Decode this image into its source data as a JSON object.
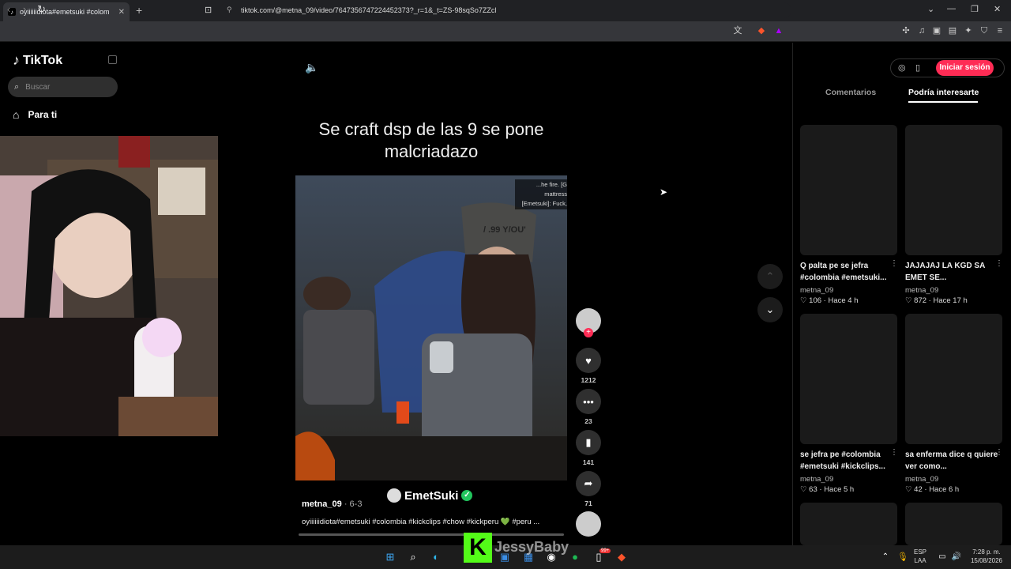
{
  "browser": {
    "tab_title": "oyiiiiiidiota#emetsuki #colom",
    "url": "tiktok.com/@metna_09/video/7647356747224452373?_r=1&_t=ZS-98sqSo7ZZcl"
  },
  "sidebar": {
    "logo": "TikTok",
    "search_placeholder": "Buscar",
    "nav_for_you": "Para ti"
  },
  "video": {
    "overlay_title": "Se craft dsp de las 9 se pone malcriadazo",
    "subtitles": [
      "...he fire. [G",
      "mattress",
      "[Emetsuki]: Fuck,"
    ],
    "cap_text": "/ .99 Y/OU'",
    "watermark": "EmetSuki",
    "author": "metna_09",
    "date": "6-3",
    "description": "oyiiiiiidiota#emetsuki #colombia #kickclips #chow #kickperu 💚 #peru ...",
    "progress": 0.0
  },
  "actions": {
    "likes": "1212",
    "comments": "23",
    "saves": "141",
    "shares": "71"
  },
  "panel": {
    "login": "Iniciar sesión",
    "tab_comments": "Comentarios",
    "tab_suggested": "Podría interesarte",
    "cards": [
      {
        "title": "Q palta pe se jefra #colombia #emetsuki...",
        "user": "metna_09",
        "likes": "106",
        "age": "Hace 4 h"
      },
      {
        "title": "JAJAJAJ LA KGD SA EMET SE...",
        "user": "metna_09",
        "likes": "872",
        "age": "Hace 17 h"
      },
      {
        "title": "se jefra pe #colombia #emetsuki #kickclips...",
        "user": "metna_09",
        "likes": "63",
        "age": "Hace 5 h"
      },
      {
        "title": "sa enferma dice q quiere ver como...",
        "user": "metna_09",
        "likes": "42",
        "age": "Hace 6 h"
      }
    ]
  },
  "overlay": {
    "kick_letter": "K",
    "streamer": "JessyBaby"
  },
  "taskbar": {
    "lang_top": "ESP",
    "lang_bottom": "LAA",
    "time": "7:28 p. m.",
    "date": "15/08/2026",
    "badge": "99+"
  },
  "colors": {
    "accent": "#fe2c55",
    "kick_green": "#53fc18",
    "verified": "#20d5ec"
  }
}
